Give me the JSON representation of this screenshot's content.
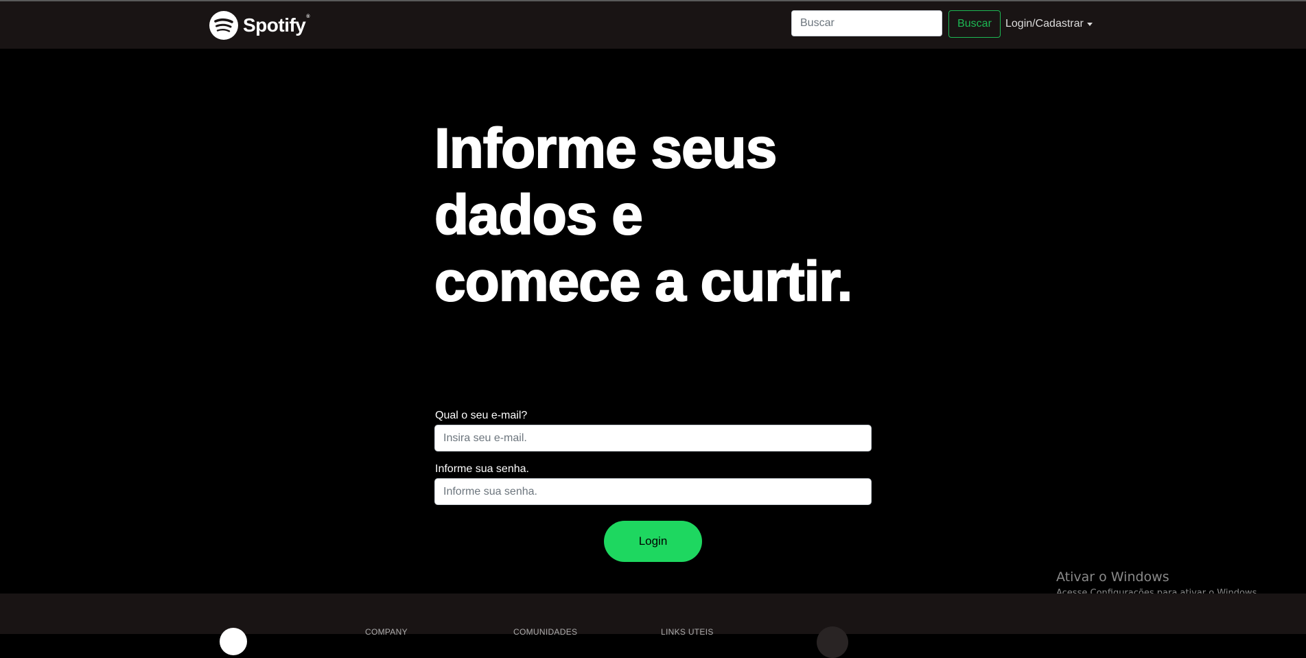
{
  "navbar": {
    "logo_text": "Spotify",
    "logo_registered": "®",
    "search_placeholder": "Buscar",
    "search_button": "Buscar",
    "login_dropdown": "Login/Cadastrar"
  },
  "main": {
    "headline": "Informe seus dados e comece a curtir.",
    "email_label": "Qual o seu e-mail?",
    "email_placeholder": "Insira seu e-mail.",
    "password_label": "Informe sua senha.",
    "password_placeholder": "Informe sua senha.",
    "login_button": "Login"
  },
  "footer": {
    "headings": [
      "COMPANY",
      "COMUNIDADES",
      "LINKS UTEIS"
    ]
  },
  "watermark": {
    "title": "Ativar o Windows",
    "subtitle": "Acesse Configurações para ativar o Windows."
  },
  "colors": {
    "navbar_bg": "#191414",
    "accent": "#1ed760",
    "button_outline": "#1db954"
  },
  "icons": {
    "logo": "spotify-logo-icon",
    "dropdown": "caret-down-icon"
  }
}
